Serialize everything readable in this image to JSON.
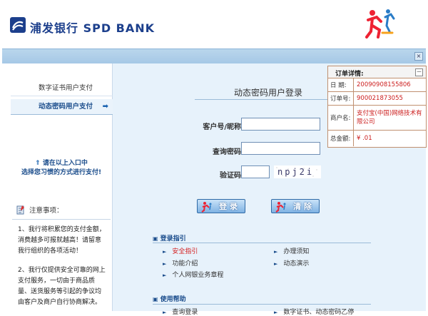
{
  "header": {
    "bank_name": "浦发银行 SPD BANK"
  },
  "sidebar": {
    "items": [
      {
        "label": "数字证书用户支付"
      },
      {
        "label": "动态密码用户支付"
      }
    ],
    "hint": "请在以上入口中\n选择您习惯的方式进行支付!",
    "notice_title": "注意事项：",
    "notices": [
      "1、我行将积累您的支付金额，消费越多可报就越高！请留意我行组织的各项活动！",
      "2、我行仅提供安全可靠的网上支付服务，一切由于商品质量、送货服务等引起的争议均由客户及商户自行协商解决。"
    ]
  },
  "login": {
    "title": "动态密码用户登录",
    "user_label": "客户号/昵称:",
    "user_value": "",
    "pwd_label": "查询密码:",
    "pwd_value": "",
    "code_label": "验证码:",
    "code_value": "",
    "captcha": "npj2i",
    "login_button": "登 录",
    "clear_button": "清 除"
  },
  "guide": {
    "title": "登录指引",
    "links": [
      "安全指引",
      "办理须知",
      "功能介绍",
      "动态演示",
      "个人网银业务章程"
    ]
  },
  "help": {
    "title": "使用帮助",
    "links": [
      "查询登录",
      "数字证书、动态密码乙停"
    ]
  },
  "order": {
    "title": "订单详情:",
    "collapse": "－",
    "rows": [
      {
        "label": "日 期:",
        "value": "20090908155806"
      },
      {
        "label": "订单号:",
        "value": "900021873055"
      },
      {
        "label": "商户名:",
        "value": "支付宝(中国)网络技术有限公司"
      },
      {
        "label": "总金额:",
        "value": "¥ .01"
      }
    ]
  },
  "colors": {
    "brand": "#1c3f8c",
    "main_bg": "#e7f2fb",
    "accent_red": "#cc1e1e"
  }
}
